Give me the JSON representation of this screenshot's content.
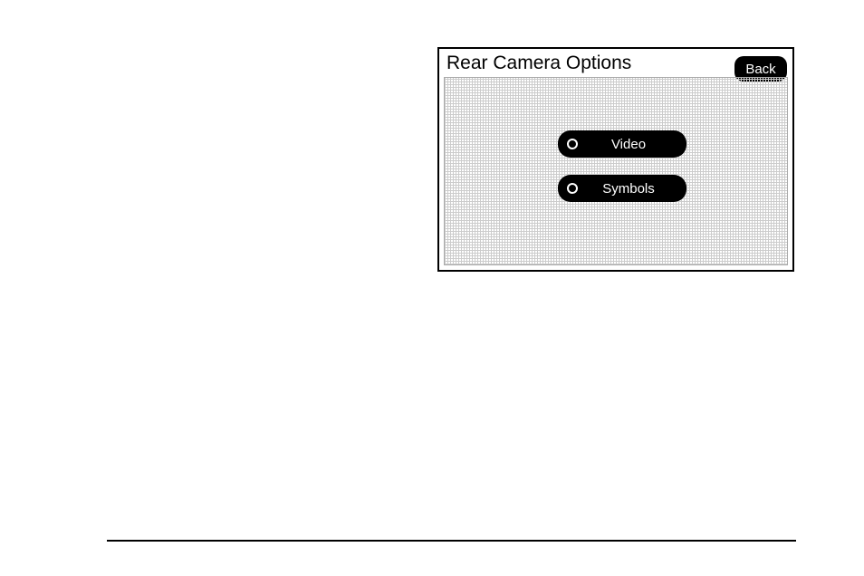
{
  "header": {
    "title": "Rear Camera Options",
    "back_label": "Back"
  },
  "options": {
    "video_label": "Video",
    "symbols_label": "Symbols"
  }
}
